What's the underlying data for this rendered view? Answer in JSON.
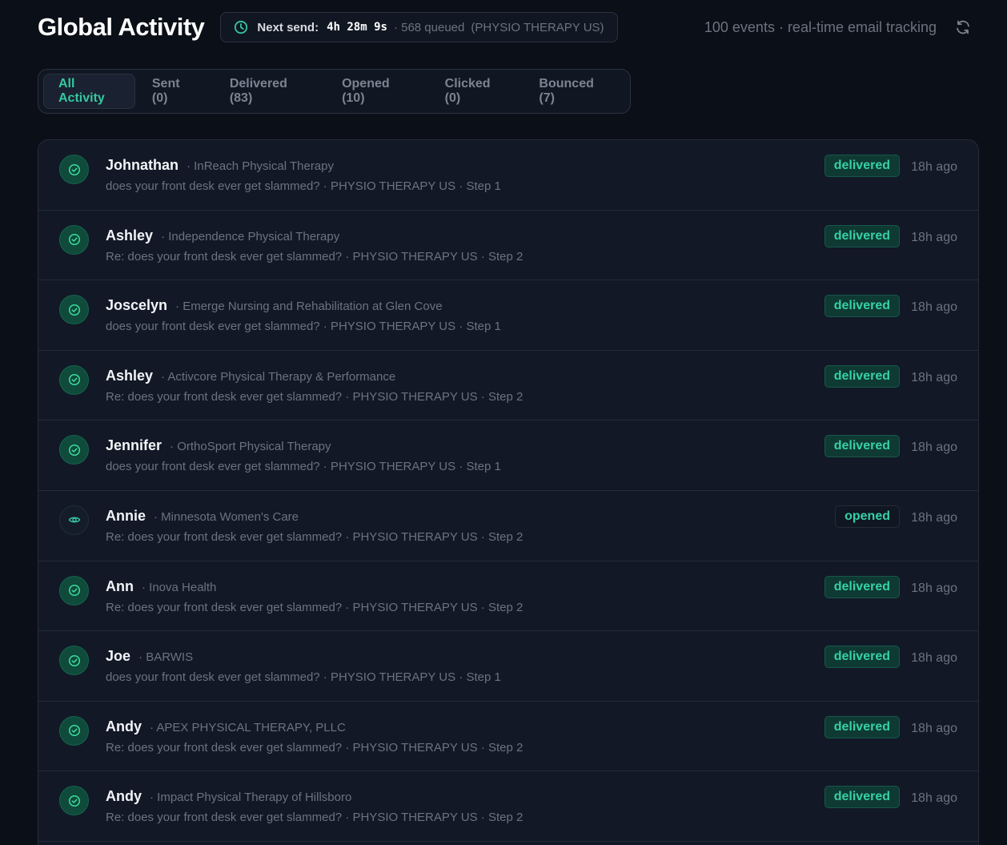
{
  "header": {
    "title": "Global Activity",
    "next_send_label": "Next send:",
    "next_send_time": "4h 28m 9s",
    "queued_text": "· 568 queued",
    "campaign_text": "(PHYSIO THERAPY US)",
    "events_text": "100 events · real-time email tracking",
    "refresh_icon": "refresh-icon",
    "clock_icon": "clock-icon"
  },
  "tabs": [
    {
      "label": "All Activity",
      "active": true
    },
    {
      "label": "Sent (0)",
      "active": false
    },
    {
      "label": "Delivered (83)",
      "active": false
    },
    {
      "label": "Opened (10)",
      "active": false
    },
    {
      "label": "Clicked (0)",
      "active": false
    },
    {
      "label": "Bounced (7)",
      "active": false
    }
  ],
  "colors": {
    "accent": "#36d1a6",
    "background": "#0b0f17",
    "panel": "#121826"
  },
  "events": [
    {
      "name": "Johnathan",
      "company": "· InReach Physical Therapy",
      "subject": "does your front desk ever get slammed? · PHYSIO THERAPY US · Step 1",
      "status": "delivered",
      "time": "18h ago"
    },
    {
      "name": "Ashley",
      "company": "· Independence Physical Therapy",
      "subject": "Re: does your front desk ever get slammed? · PHYSIO THERAPY US · Step 2",
      "status": "delivered",
      "time": "18h ago"
    },
    {
      "name": "Joscelyn",
      "company": "· Emerge Nursing and Rehabilitation at Glen Cove",
      "subject": "does your front desk ever get slammed? · PHYSIO THERAPY US · Step 1",
      "status": "delivered",
      "time": "18h ago"
    },
    {
      "name": "Ashley",
      "company": "· Activcore Physical Therapy & Performance",
      "subject": "Re: does your front desk ever get slammed? · PHYSIO THERAPY US · Step 2",
      "status": "delivered",
      "time": "18h ago"
    },
    {
      "name": "Jennifer",
      "company": "· OrthoSport Physical Therapy",
      "subject": "does your front desk ever get slammed? · PHYSIO THERAPY US · Step 1",
      "status": "delivered",
      "time": "18h ago"
    },
    {
      "name": "Annie",
      "company": "· Minnesota Women's Care",
      "subject": "Re: does your front desk ever get slammed? · PHYSIO THERAPY US · Step 2",
      "status": "opened",
      "time": "18h ago"
    },
    {
      "name": "Ann",
      "company": "· Inova Health",
      "subject": "Re: does your front desk ever get slammed? · PHYSIO THERAPY US · Step 2",
      "status": "delivered",
      "time": "18h ago"
    },
    {
      "name": "Joe",
      "company": "· BARWIS",
      "subject": "does your front desk ever get slammed? · PHYSIO THERAPY US · Step 1",
      "status": "delivered",
      "time": "18h ago"
    },
    {
      "name": "Andy",
      "company": "· APEX PHYSICAL THERAPY, PLLC",
      "subject": "Re: does your front desk ever get slammed? · PHYSIO THERAPY US · Step 2",
      "status": "delivered",
      "time": "18h ago"
    },
    {
      "name": "Andy",
      "company": "· Impact Physical Therapy of Hillsboro",
      "subject": "Re: does your front desk ever get slammed? · PHYSIO THERAPY US · Step 2",
      "status": "delivered",
      "time": "18h ago"
    }
  ]
}
